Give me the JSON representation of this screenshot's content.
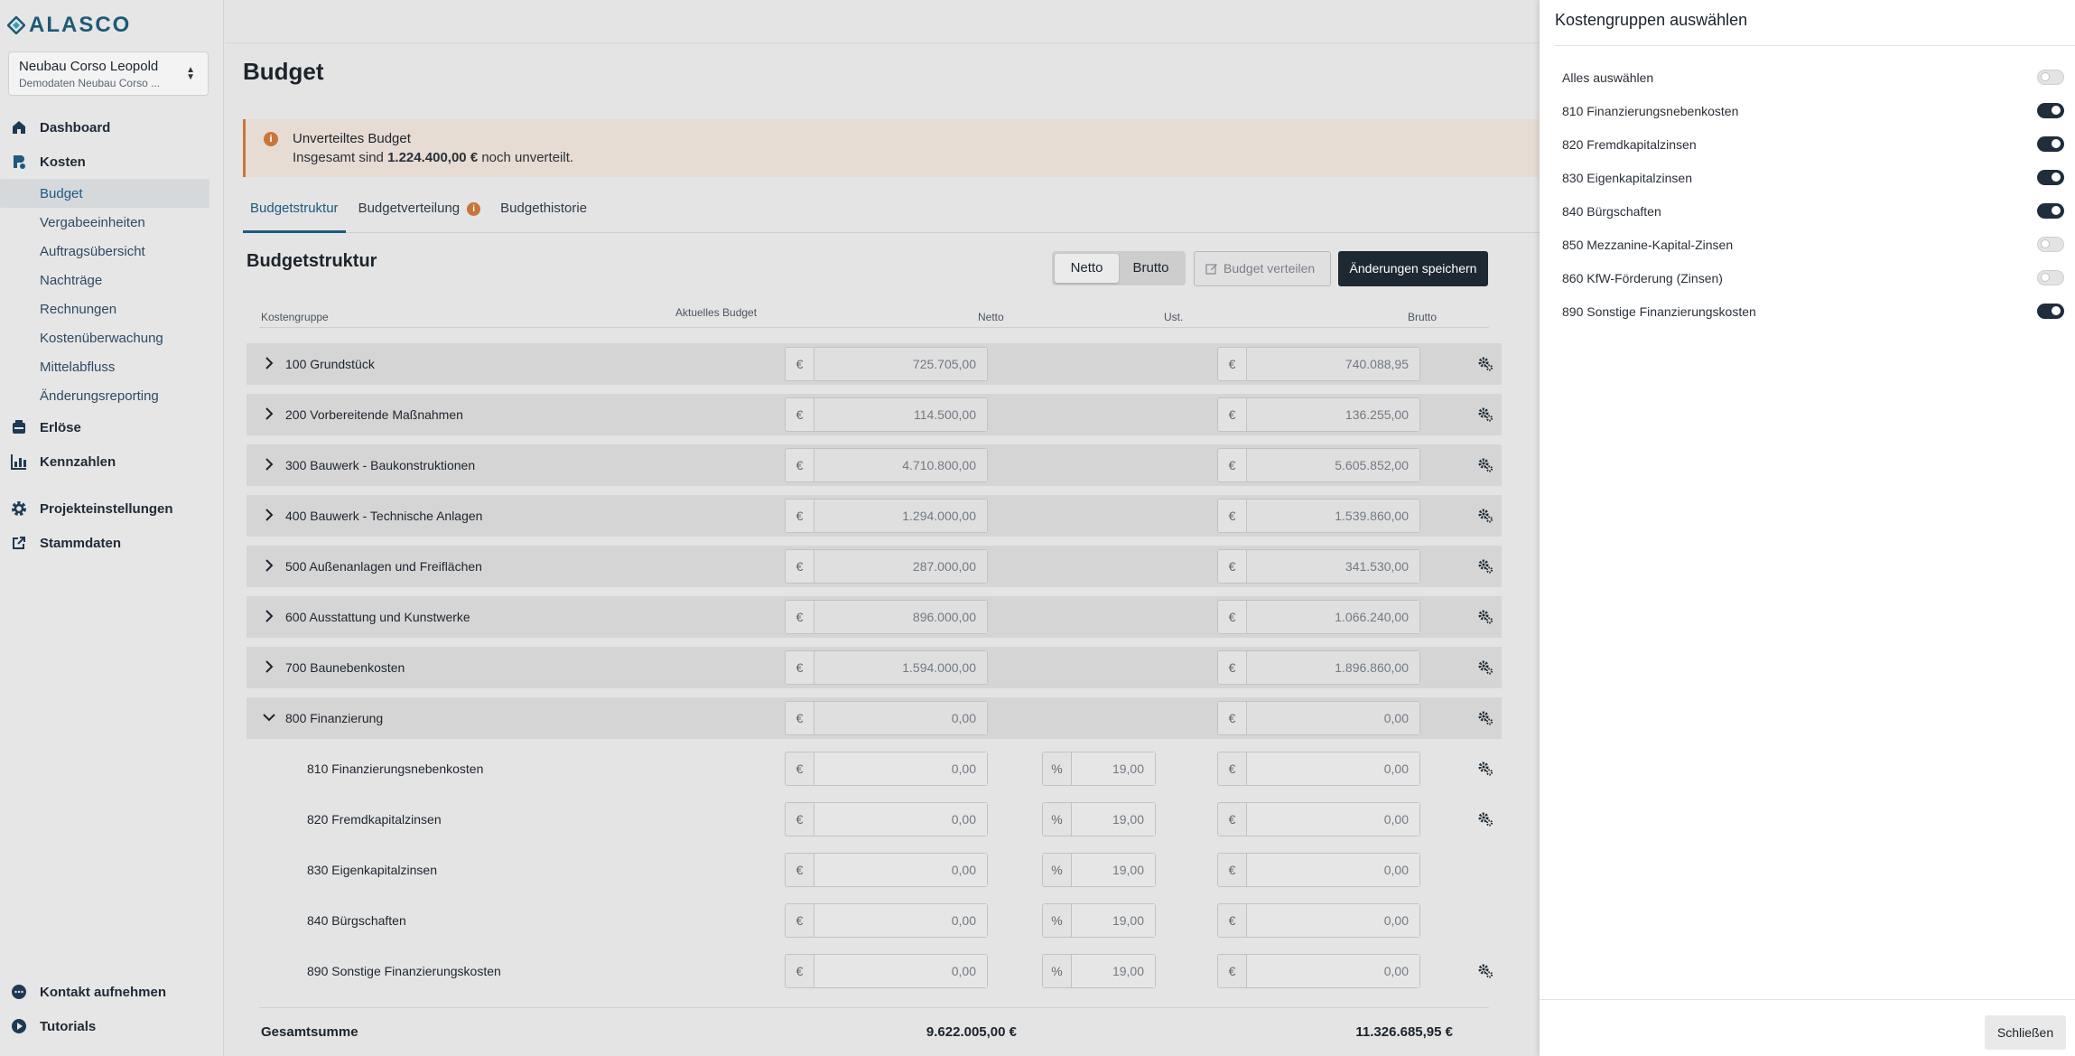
{
  "brand": {
    "name": "ALASCO"
  },
  "project": {
    "name": "Neubau Corso Leopold",
    "sub": "Demodaten Neubau Corso ..."
  },
  "nav": {
    "dashboard": "Dashboard",
    "kosten": "Kosten",
    "kosten_items": [
      "Budget",
      "Vergabeeinheiten",
      "Auftragsübersicht",
      "Nachträge",
      "Rechnungen",
      "Kostenüberwachung",
      "Mittelabfluss",
      "Änderungsreporting"
    ],
    "erloese": "Erlöse",
    "kennzahlen": "Kennzahlen",
    "projekteinstellungen": "Projekteinstellungen",
    "stammdaten": "Stammdaten",
    "kontakt": "Kontakt aufnehmen",
    "tutorials": "Tutorials"
  },
  "page": {
    "title": "Budget"
  },
  "alert": {
    "title": "Unverteiltes Budget",
    "text_pre": "Insgesamt sind ",
    "amount": "1.224.400,00 €",
    "text_post": " noch unverteilt."
  },
  "tabs": [
    "Budgetstruktur",
    "Budgetverteilung",
    "Budgethistorie"
  ],
  "section": {
    "title": "Budgetstruktur",
    "toggle": [
      "Netto",
      "Brutto"
    ],
    "distribute_label": "Budget verteilen",
    "save_label": "Änderungen speichern"
  },
  "columns": {
    "kostengruppe": "Kostengruppe",
    "aktuelles_budget": "Aktuelles Budget",
    "netto": "Netto",
    "ust": "Ust.",
    "brutto": "Brutto"
  },
  "currency_symbol": "€",
  "percent_symbol": "%",
  "rows": [
    {
      "label": "100 Grundstück",
      "netto": "725.705,00",
      "brutto": "740.088,95"
    },
    {
      "label": "200 Vorbereitende Maßnahmen",
      "netto": "114.500,00",
      "brutto": "136.255,00"
    },
    {
      "label": "300 Bauwerk - Baukonstruktionen",
      "netto": "4.710.800,00",
      "brutto": "5.605.852,00"
    },
    {
      "label": "400 Bauwerk - Technische Anlagen",
      "netto": "1.294.000,00",
      "brutto": "1.539.860,00"
    },
    {
      "label": "500 Außenanlagen und Freiflächen",
      "netto": "287.000,00",
      "brutto": "341.530,00"
    },
    {
      "label": "600 Ausstattung und Kunstwerke",
      "netto": "896.000,00",
      "brutto": "1.066.240,00"
    },
    {
      "label": "700 Baunebenkosten",
      "netto": "1.594.000,00",
      "brutto": "1.896.860,00"
    },
    {
      "label": "800 Finanzierung",
      "netto": "0,00",
      "brutto": "0,00"
    }
  ],
  "subrows": [
    {
      "label": "810 Finanzierungsnebenkosten",
      "netto": "0,00",
      "ust": "19,00",
      "brutto": "0,00"
    },
    {
      "label": "820 Fremdkapitalzinsen",
      "netto": "0,00",
      "ust": "19,00",
      "brutto": "0,00"
    },
    {
      "label": "830 Eigenkapitalzinsen",
      "netto": "0,00",
      "ust": "19,00",
      "brutto": "0,00"
    },
    {
      "label": "840 Bürgschaften",
      "netto": "0,00",
      "ust": "19,00",
      "brutto": "0,00"
    },
    {
      "label": "890 Sonstige Finanzierungskosten",
      "netto": "0,00",
      "ust": "19,00",
      "brutto": "0,00"
    }
  ],
  "total": {
    "label": "Gesamtsumme",
    "netto": "9.622.005,00 €",
    "brutto": "11.326.685,95 €"
  },
  "drawer": {
    "title": "Kostengruppen auswählen",
    "options": [
      {
        "label": "Alles auswählen",
        "on": false
      },
      {
        "label": "810 Finanzierungsnebenkosten",
        "on": true
      },
      {
        "label": "820 Fremdkapitalzinsen",
        "on": true
      },
      {
        "label": "830 Eigenkapitalzinsen",
        "on": true
      },
      {
        "label": "840 Bürgschaften",
        "on": true
      },
      {
        "label": "850 Mezzanine-Kapital-Zinsen",
        "on": false
      },
      {
        "label": "860 KfW-Förderung (Zinsen)",
        "on": false
      },
      {
        "label": "890 Sonstige Finanzierungskosten",
        "on": true
      }
    ],
    "close_label": "Schließen"
  },
  "colors": {
    "accent": "#1c5a80",
    "warning": "#c9753a",
    "dark": "#1e2832"
  }
}
